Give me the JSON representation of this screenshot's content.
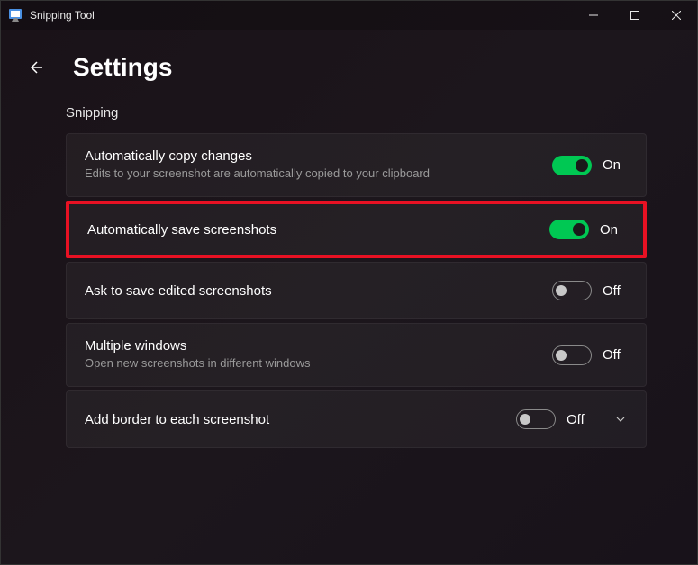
{
  "titlebar": {
    "title": "Snipping Tool"
  },
  "header": {
    "page_title": "Settings"
  },
  "section": {
    "title": "Snipping"
  },
  "settings": [
    {
      "title": "Automatically copy changes",
      "desc": "Edits to your screenshot are automatically copied to your clipboard",
      "state": "On"
    },
    {
      "title": "Automatically save screenshots",
      "desc": "",
      "state": "On"
    },
    {
      "title": "Ask to save edited screenshots",
      "desc": "",
      "state": "Off"
    },
    {
      "title": "Multiple windows",
      "desc": "Open new screenshots in different windows",
      "state": "Off"
    },
    {
      "title": "Add border to each screenshot",
      "desc": "",
      "state": "Off"
    }
  ]
}
